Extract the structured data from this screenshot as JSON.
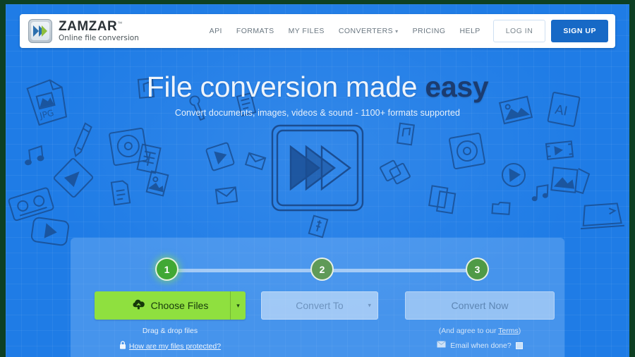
{
  "frame": {
    "chrome_color": "#0d4024"
  },
  "theme": {
    "page_blue": "#1f7ce6",
    "accent_green": "#8fe03f",
    "step_active_green": "#41a834",
    "signup_blue": "#1769c6",
    "headline_accent": "#1b3c70",
    "doodle_ink": "#1a4f93"
  },
  "header": {
    "logo": {
      "word": "ZAMZAR",
      "trademark": "™",
      "tagline": "Online file conversion",
      "mark_icon": "double-chevron-icon"
    },
    "nav": [
      {
        "label": "API",
        "has_caret": false
      },
      {
        "label": "FORMATS",
        "has_caret": false
      },
      {
        "label": "MY FILES",
        "has_caret": false
      },
      {
        "label": "CONVERTERS",
        "has_caret": true,
        "caret": "▾"
      },
      {
        "label": "PRICING",
        "has_caret": false
      },
      {
        "label": "HELP",
        "has_caret": false
      }
    ],
    "login_label": "LOG IN",
    "signup_label": "SIGN UP"
  },
  "hero": {
    "headline_plain": "File conversion made ",
    "headline_accent": "easy",
    "subhead": "Convert documents, images, videos & sound - 1100+ formats supported",
    "center_graphic": "fast-forward-sketch-icon"
  },
  "converter": {
    "steps": [
      {
        "number": "1",
        "state": "active"
      },
      {
        "number": "2",
        "state": "inactive"
      },
      {
        "number": "3",
        "state": "inactive"
      }
    ],
    "choose_files_label": "Choose Files",
    "choose_files_icon": "cloud-upload-icon",
    "choose_files_caret": "▾",
    "convert_to_label": "Convert To",
    "convert_to_caret": "▾",
    "convert_now_label": "Convert Now",
    "drag_drop_note": "Drag & drop files",
    "protected_link": "How are my files protected?",
    "protected_icon": "padlock-icon",
    "terms_prefix": "(And agree to our ",
    "terms_link": "Terms",
    "terms_suffix": ")",
    "email_when_done_label": "Email when done?",
    "email_icon": "envelope-icon",
    "email_checkbox_checked": false
  }
}
